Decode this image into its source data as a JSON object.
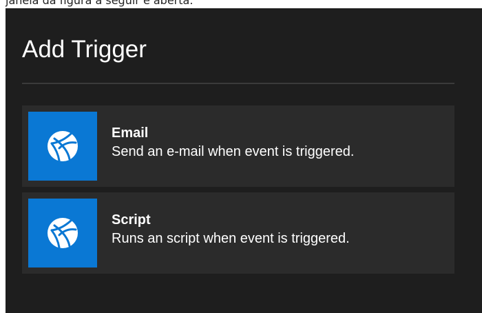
{
  "caption": "janela da figura a seguir é aberta.",
  "dialog": {
    "title": "Add Trigger",
    "items": [
      {
        "name": "Email",
        "description": "Send an e-mail when event is triggered.",
        "icon": "globe-network-icon"
      },
      {
        "name": "Script",
        "description": "Runs an script when event is triggered.",
        "icon": "globe-network-icon"
      }
    ]
  },
  "colors": {
    "background": "#1e1e1e",
    "item_background": "#2b2b2b",
    "tile_accent": "#0a78d4",
    "text": "#ffffff"
  }
}
